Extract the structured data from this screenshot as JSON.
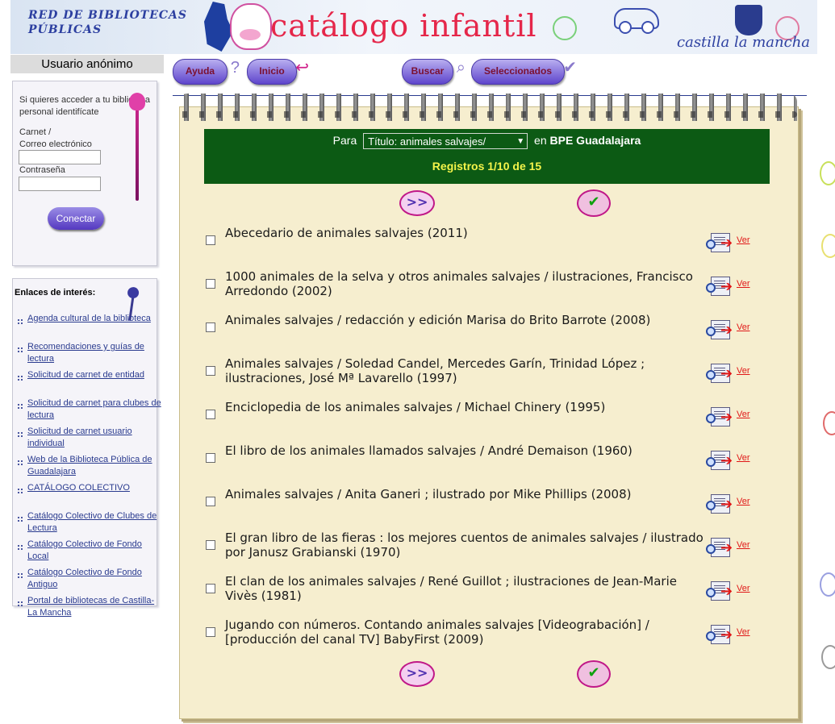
{
  "header": {
    "network_label": "RED DE BIBLIOTECAS PÚBLICAS",
    "title": "catálogo infantil",
    "region": "castilla la mancha"
  },
  "sidebar": {
    "user_title": "Usuario anónimo",
    "login": {
      "intro": "Si quieres acceder a tu biblioteca personal identifícate",
      "carnet_label": "Carnet /",
      "email_label": "Correo electrónico",
      "carnet_value": "",
      "password_label": "Contraseña",
      "password_value": "",
      "connect_label": "Conectar"
    },
    "links_title": "Enlaces de interés:",
    "links": [
      "Agenda cultural de la biblioteca",
      "Recomendaciones y guías de lectura",
      "Solicitud de carnet de entidad",
      "Solicitud de carnet para clubes de lectura",
      "Solicitud de carnet usuario individual",
      "Web de la Biblioteca Pública de Guadalajara",
      "CATÁLOGO COLECTIVO",
      "Catálogo Colectivo de Clubes de Lectura",
      "Catálogo Colectivo de Fondo Local",
      "Catálogo Colectivo de Fondo Antiguo",
      "Portal de bibliotecas de Castilla-La Mancha"
    ]
  },
  "toolbar": {
    "help": "Ayuda",
    "home": "Inicio",
    "search": "Buscar",
    "selected": "Seleccionados"
  },
  "search": {
    "prefix": "Para",
    "select_value": "Título: animales salvajes/",
    "in_label": "en",
    "library": "BPE Guadalajara",
    "records": "Registros 1/10 de 15"
  },
  "results": [
    {
      "text": "Abecedario de animales salvajes   (2011)",
      "ver": "Ver"
    },
    {
      "text": "1000 animales de la selva y otros animales salvajes / ilustraciones, Francisco Arredondo   (2002)",
      "ver": "Ver"
    },
    {
      "text": "Animales salvajes / redacción y edición Marisa do Brito Barrote   (2008)",
      "ver": "Ver"
    },
    {
      "text": "Animales salvajes / Soledad Candel, Mercedes Garín, Trinidad López ; ilustraciones, José Mª Lavarello   (1997)",
      "ver": "Ver"
    },
    {
      "text": "Enciclopedia de los animales salvajes / Michael Chinery   (1995)",
      "ver": "Ver"
    },
    {
      "text": "El libro de los animales llamados salvajes / André Demaison   (1960)",
      "ver": "Ver"
    },
    {
      "text": "Animales salvajes / Anita Ganeri ; ilustrado por Mike Phillips   (2008)",
      "ver": "Ver"
    },
    {
      "text": "El gran libro de las fieras : los mejores cuentos de animales salvajes / ilustrado por Janusz Grabianski   (1970)",
      "ver": "Ver"
    },
    {
      "text": "El clan de los animales salvajes / René Guillot ; ilustraciones de Jean-Marie Vivès   (1981)",
      "ver": "Ver"
    },
    {
      "text": "Jugando con números. Contando animales salvajes [Videograbación] / [producción del canal TV] BabyFirst   (2009)",
      "ver": "Ver"
    }
  ],
  "colors": {
    "search_panel": "#0c5a14",
    "records_text": "#f4f44a",
    "link": "#2a3b8f",
    "ver_link": "#e01818",
    "notebook": "#f6eecf"
  }
}
